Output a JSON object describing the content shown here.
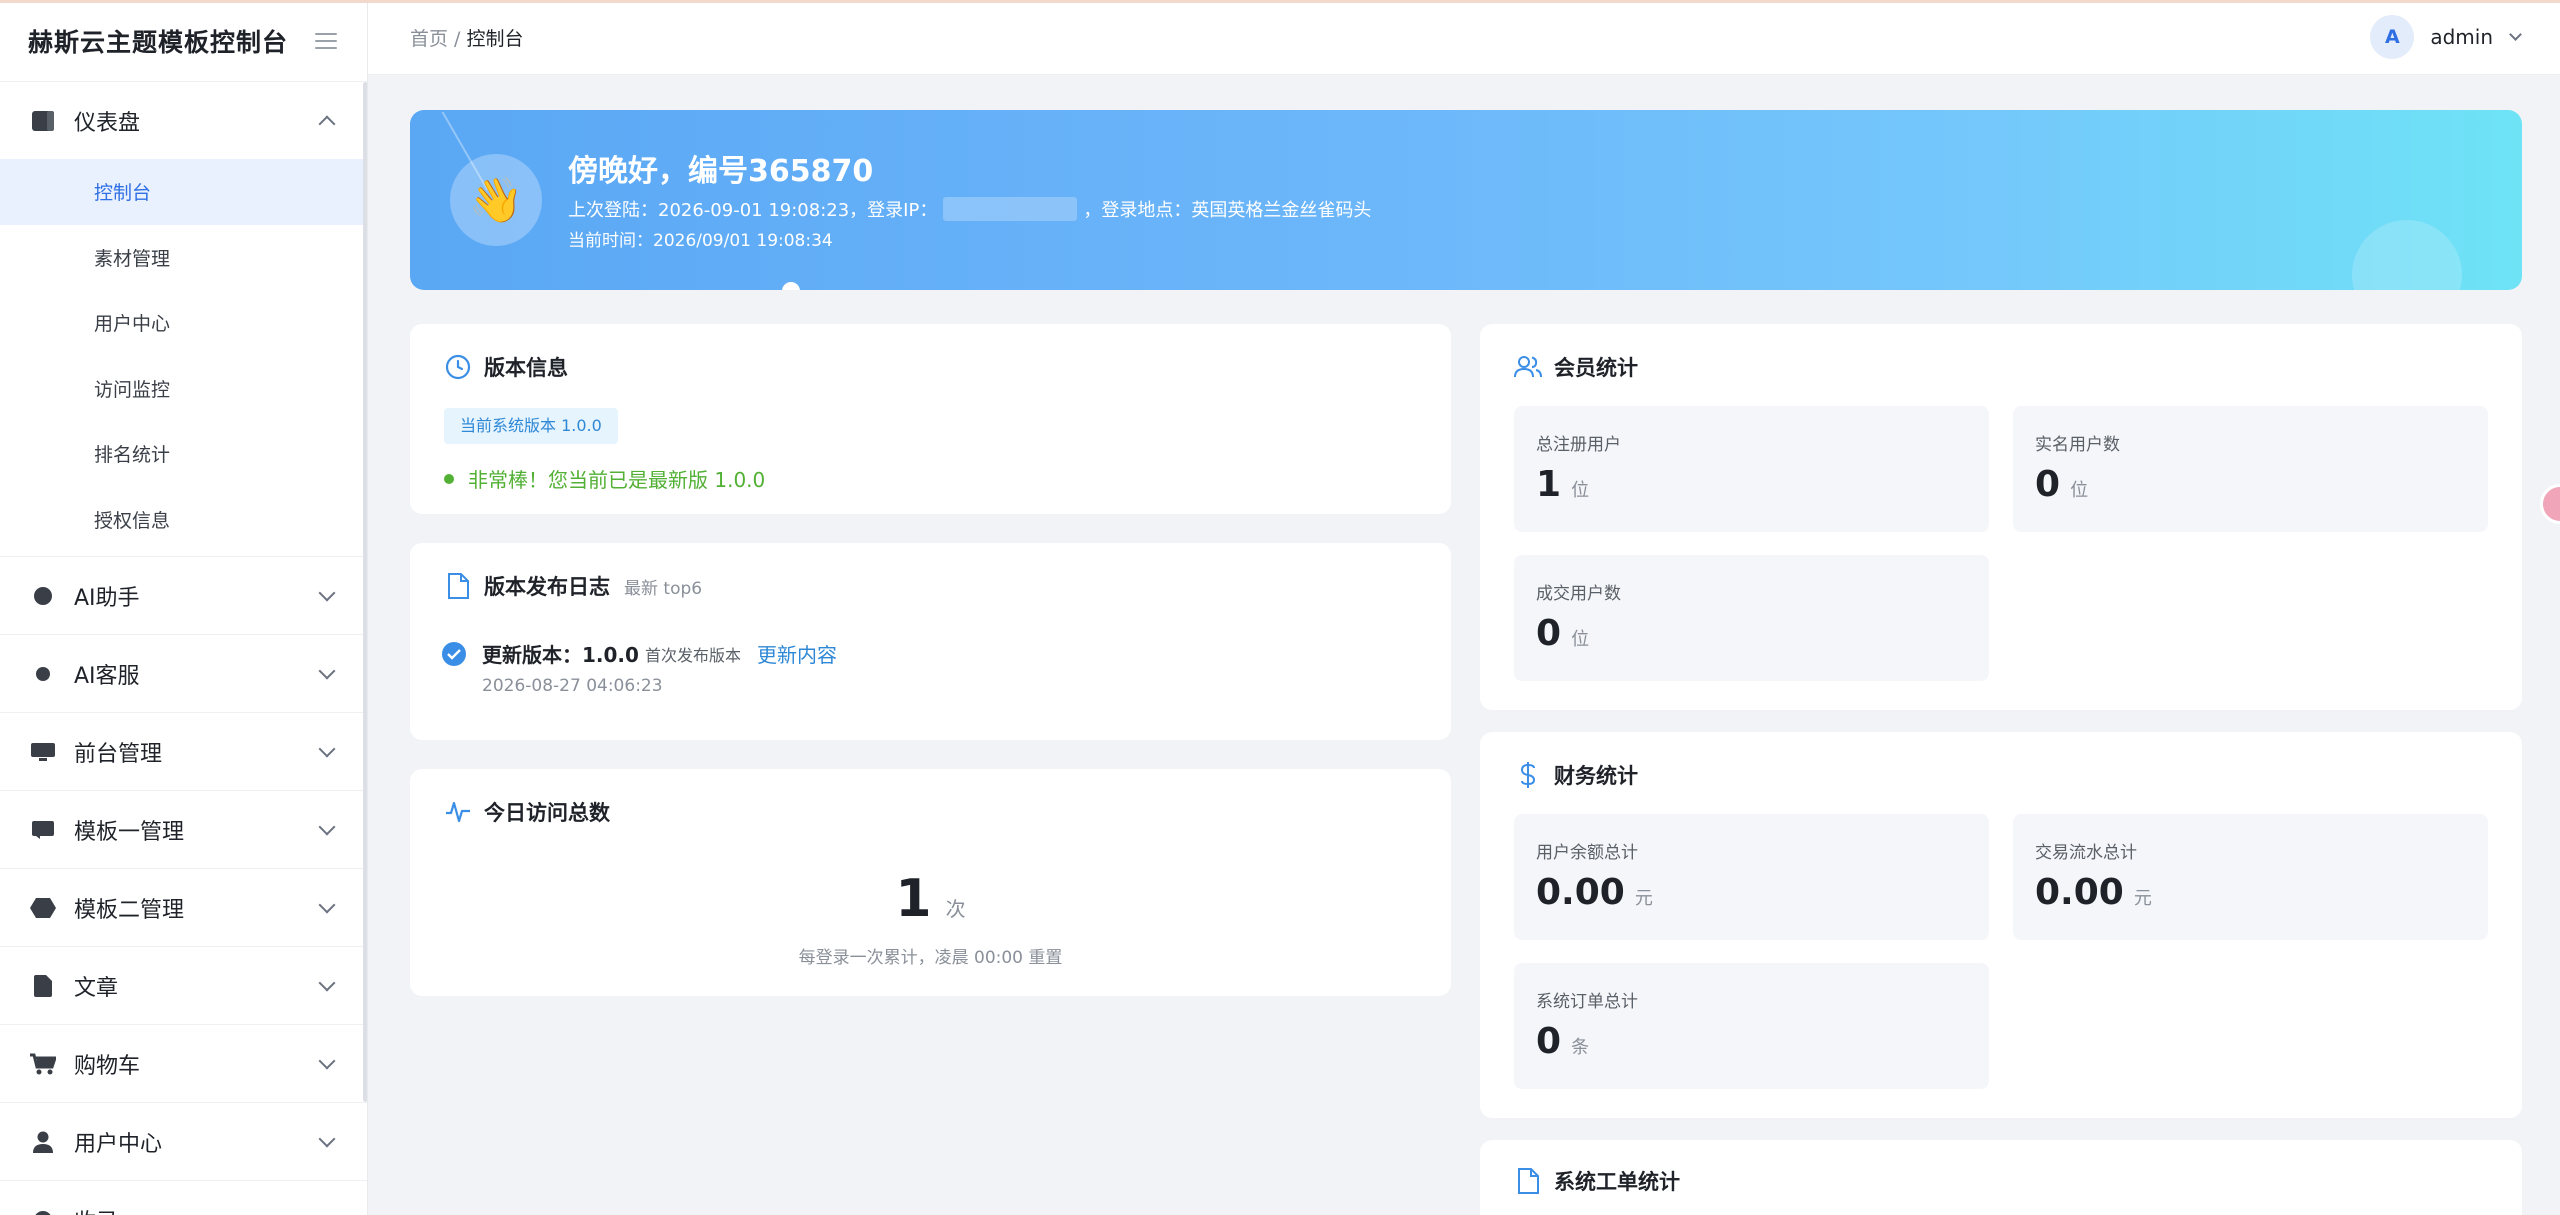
{
  "app": {
    "title": "赫斯云主题模板控制台"
  },
  "sidebar": {
    "groups": [
      {
        "label": "仪表盘",
        "icon": "dashboard-icon",
        "expanded": true,
        "items": [
          {
            "label": "控制台",
            "active": true
          },
          {
            "label": "素材管理"
          },
          {
            "label": "用户中心"
          },
          {
            "label": "访问监控"
          },
          {
            "label": "排名统计"
          },
          {
            "label": "授权信息"
          }
        ]
      },
      {
        "label": "AI助手",
        "icon": "ai-assistant-icon"
      },
      {
        "label": "AI客服",
        "icon": "ai-service-icon"
      },
      {
        "label": "前台管理",
        "icon": "monitor-icon"
      },
      {
        "label": "模板一管理",
        "icon": "template-icon"
      },
      {
        "label": "模板二管理",
        "icon": "hexagon-icon"
      },
      {
        "label": "文章",
        "icon": "document-icon"
      },
      {
        "label": "购物车",
        "icon": "cart-icon"
      },
      {
        "label": "用户中心",
        "icon": "user-icon"
      },
      {
        "label": "收录",
        "icon": "index-icon"
      }
    ]
  },
  "header": {
    "breadcrumb_home": "首页",
    "breadcrumb_sep": " / ",
    "breadcrumb_current": "控制台",
    "avatar_letter": "A",
    "username": "admin"
  },
  "banner": {
    "greeting": "傍晚好，编号365870",
    "last_login_prefix": "上次登陆：2026-09-01 19:08:23，登录IP：",
    "last_login_suffix": "，登录地点：英国英格兰金丝雀码头",
    "current_time": "当前时间：2026/09/01 19:08:34",
    "emoji": "👋"
  },
  "version_card": {
    "title": "版本信息",
    "tag": "当前系统版本 1.0.0",
    "status": "非常棒！您当前已是最新版 1.0.0"
  },
  "changelog_card": {
    "title": "版本发布日志",
    "subtitle": "最新 top6",
    "entries": [
      {
        "label": "更新版本：1.0.0",
        "note": "首次发布版本",
        "link": "更新内容",
        "date": "2026-08-27 04:06:23"
      }
    ]
  },
  "visits_card": {
    "title": "今日访问总数",
    "count": "1",
    "unit": "次",
    "note": "每登录一次累计，凌晨 00:00 重置"
  },
  "member_card": {
    "title": "会员统计",
    "stats": [
      {
        "label": "总注册用户",
        "value": "1",
        "unit": "位"
      },
      {
        "label": "实名用户数",
        "value": "0",
        "unit": "位"
      },
      {
        "label": "成交用户数",
        "value": "0",
        "unit": "位"
      }
    ]
  },
  "finance_card": {
    "title": "财务统计",
    "stats": [
      {
        "label": "用户余额总计",
        "value": "0.00",
        "unit": "元"
      },
      {
        "label": "交易流水总计",
        "value": "0.00",
        "unit": "元"
      },
      {
        "label": "系统订单总计",
        "value": "0",
        "unit": "条"
      }
    ]
  },
  "ticket_card": {
    "title": "系统工单统计"
  },
  "colors": {
    "accent": "#2f6fe4",
    "success": "#52b034",
    "link": "#2f88d6"
  }
}
